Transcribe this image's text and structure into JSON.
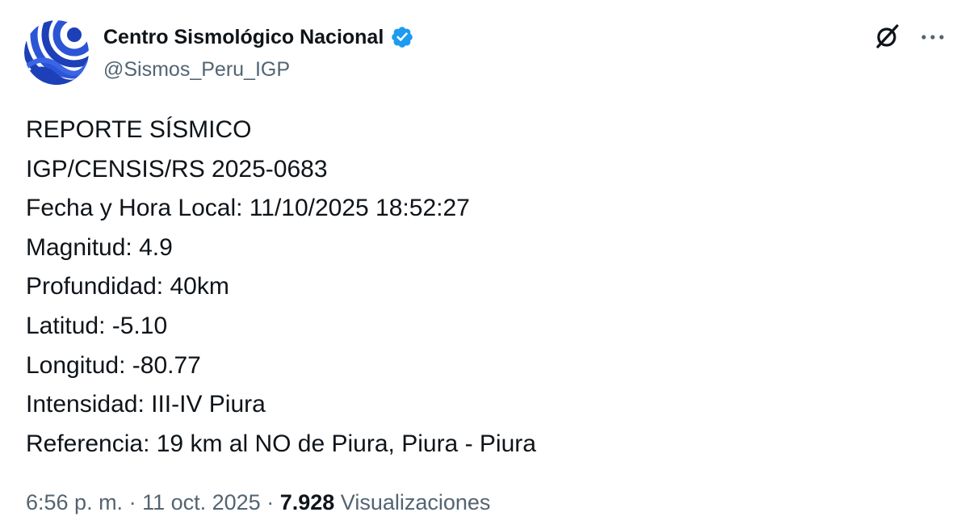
{
  "colors": {
    "text_primary": "#0f1419",
    "text_secondary": "#536471",
    "verified_badge": "#1d9bf0",
    "avatar_background": "#1d3fb8"
  },
  "author": {
    "display_name": "Centro Sismológico Nacional",
    "handle": "@Sismos_Peru_IGP",
    "verified": true,
    "avatar_icon": "seismic-logo-icon"
  },
  "actions": {
    "grok_icon": "grok-icon",
    "more_icon": "more-horizontal-icon"
  },
  "tweet": {
    "lines": [
      "REPORTE SÍSMICO",
      "IGP/CENSIS/RS 2025-0683",
      "Fecha y Hora Local: 11/10/2025 18:52:27",
      "Magnitud: 4.9",
      "Profundidad: 40km",
      "Latitud: -5.10",
      "Longitud: -80.77",
      "Intensidad: III-IV Piura",
      "Referencia: 19 km al NO de Piura, Piura - Piura"
    ]
  },
  "meta": {
    "time": "6:56 p. m.",
    "separator": " · ",
    "date": "11 oct. 2025",
    "views_count": "7.928",
    "views_label": "Visualizaciones"
  }
}
